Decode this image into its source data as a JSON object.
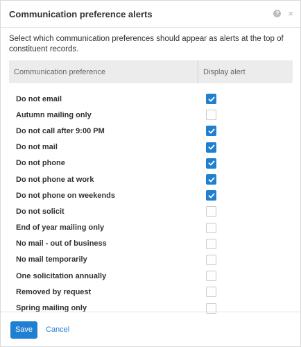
{
  "dialog": {
    "title": "Communication preference alerts",
    "help_icon": "question-circle-icon",
    "help_glyph": "?",
    "close_icon": "close-icon",
    "close_glyph": "×",
    "description": "Select which communication preferences should appear as alerts at the top of constituent records."
  },
  "table": {
    "col_pref": "Communication preference",
    "col_alert": "Display alert",
    "rows": [
      {
        "label": "Do not email",
        "checked": true
      },
      {
        "label": "Autumn mailing only",
        "checked": false
      },
      {
        "label": "Do not call after 9:00 PM",
        "checked": true
      },
      {
        "label": "Do not mail",
        "checked": true
      },
      {
        "label": "Do not phone",
        "checked": true
      },
      {
        "label": "Do not phone at work",
        "checked": true
      },
      {
        "label": "Do not phone on weekends",
        "checked": true
      },
      {
        "label": "Do not solicit",
        "checked": false
      },
      {
        "label": "End of year mailing only",
        "checked": false
      },
      {
        "label": "No mail - out of business",
        "checked": false
      },
      {
        "label": "No mail temporarily",
        "checked": false
      },
      {
        "label": "One solicitation annually",
        "checked": false
      },
      {
        "label": "Removed by request",
        "checked": false
      },
      {
        "label": "Spring mailing only",
        "checked": false
      }
    ]
  },
  "footer": {
    "save_label": "Save",
    "cancel_label": "Cancel"
  },
  "colors": {
    "accent": "#1f7fd0"
  }
}
